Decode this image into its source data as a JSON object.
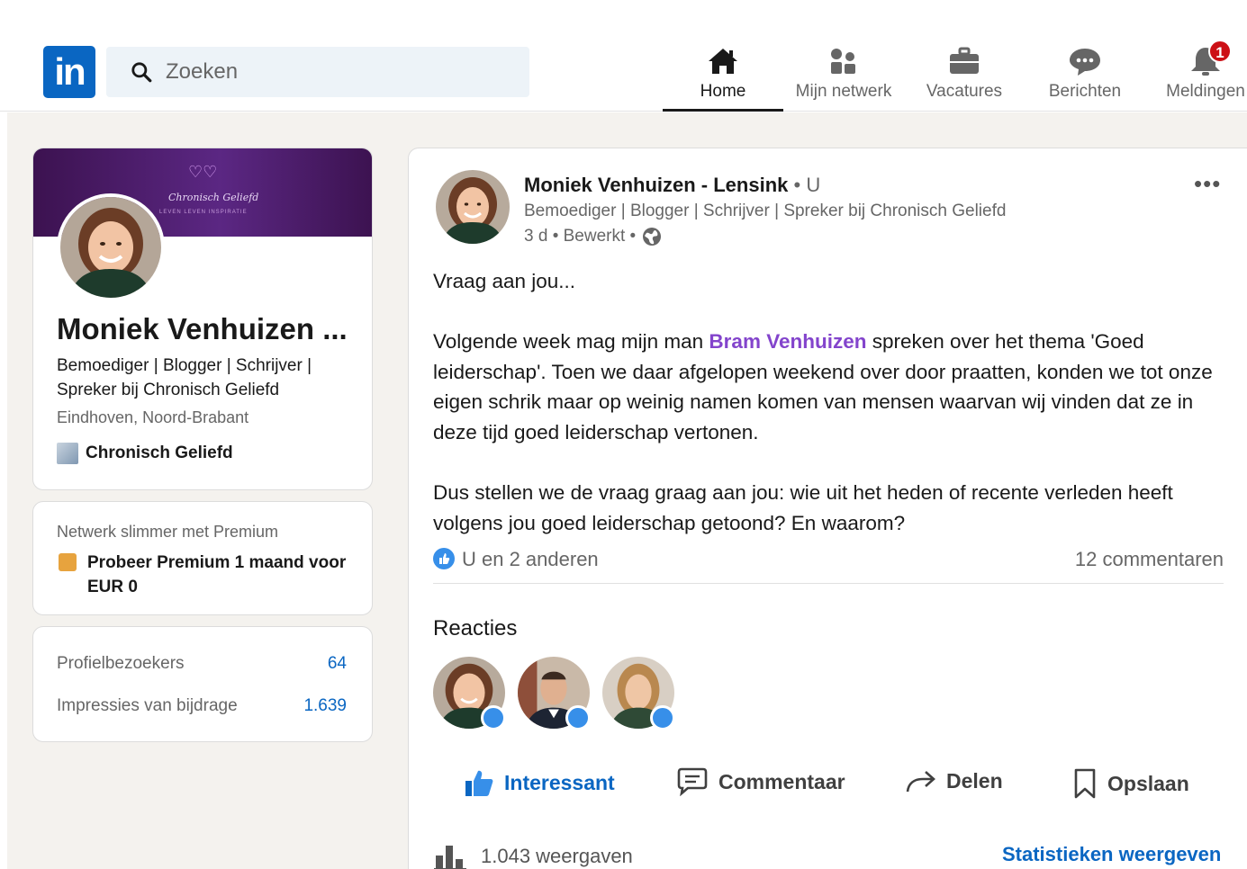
{
  "header": {
    "logo_text": "in",
    "search_placeholder": "Zoeken",
    "nav": [
      {
        "label": "Home",
        "icon": "home-icon",
        "active": true
      },
      {
        "label": "Mijn netwerk",
        "icon": "network-icon"
      },
      {
        "label": "Vacatures",
        "icon": "briefcase-icon"
      },
      {
        "label": "Berichten",
        "icon": "messaging-icon"
      },
      {
        "label": "Meldingen",
        "icon": "bell-icon",
        "badge": "1"
      }
    ]
  },
  "profile": {
    "banner_title": "Chronisch Geliefd",
    "banner_sub": "LEVEN LEVEN INSPIRATIE",
    "name": "Moniek Venhuizen ...",
    "headline": "Bemoediger | Blogger | Schrijver | Spreker bij Chronisch Geliefd",
    "location": "Eindhoven, Noord-Brabant",
    "company": "Chronisch Geliefd"
  },
  "premium": {
    "title": "Netwerk slimmer met Premium",
    "link": "Probeer Premium 1 maand voor EUR 0"
  },
  "stats": [
    {
      "label": "Profielbezoekers",
      "value": "64"
    },
    {
      "label": "Impressies van bijdrage",
      "value": "1.639"
    }
  ],
  "post": {
    "author": "Moniek Venhuizen - Lensink",
    "relation": " • U",
    "headline": "Bemoediger | Blogger | Schrijver | Spreker bij Chronisch Geliefd",
    "meta": "3 d • Bewerkt •",
    "more": "•••",
    "body_intro": "Vraag aan jou...",
    "body_p2_before": "Volgende week mag mijn man ",
    "mention": "Bram Venhuizen",
    "body_p2_after": " spreken over het thema 'Goed leiderschap'. Toen we daar afgelopen weekend over door praatten, konden we tot onze eigen schrik maar op weinig namen komen van mensen waarvan wij vinden dat ze in deze tijd goed leiderschap vertonen.",
    "body_p3": "Dus stellen we de vraag graag aan jou: wie uit het heden of recente verleden heeft volgens jou goed leiderschap getoond? En waarom?",
    "reactions_summary": "U en 2 anderen",
    "comments_count": "12 commentaren",
    "reactions_title": "Reacties",
    "actions": [
      "Interessant",
      "Commentaar",
      "Delen",
      "Opslaan"
    ],
    "views": "1.043 weergaven",
    "stats_link": "Statistieken weergeven"
  },
  "colors": {
    "brand": "#0a66c2",
    "mention": "#8344cc",
    "badge": "#cc1016",
    "background": "#f4f2ee"
  }
}
